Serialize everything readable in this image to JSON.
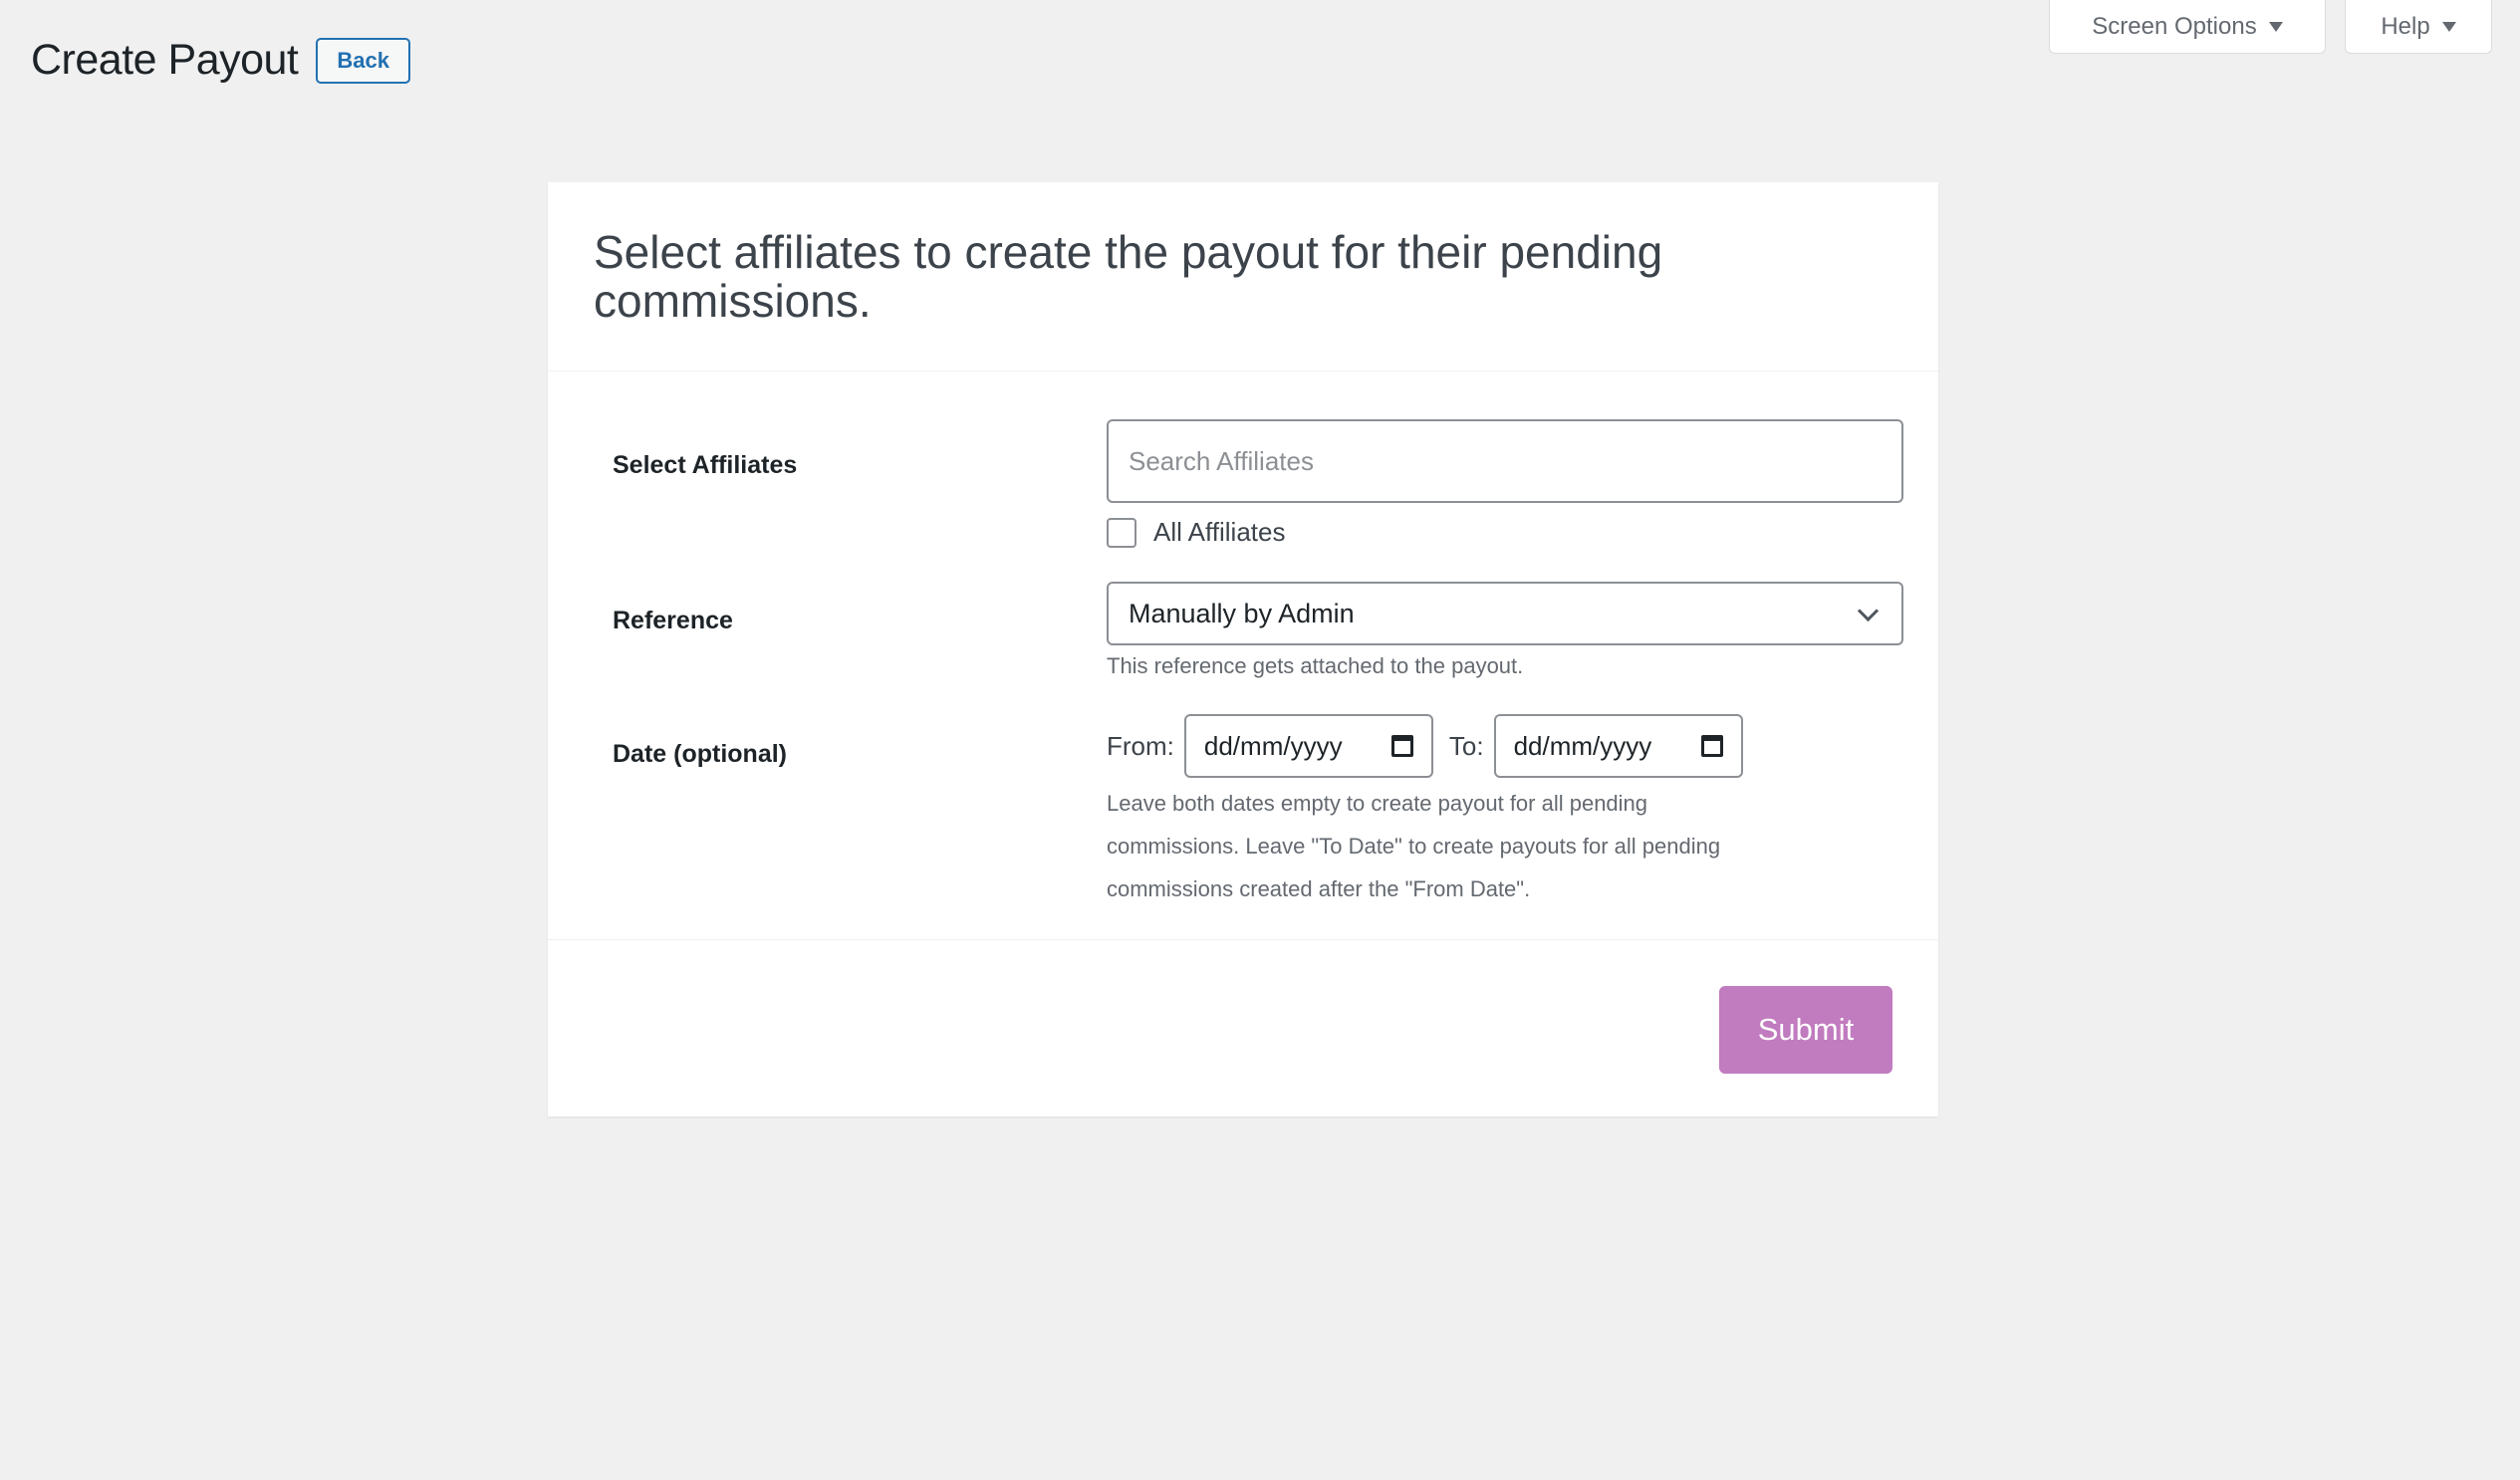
{
  "screen_meta": {
    "screen_options_label": "Screen Options",
    "help_label": "Help"
  },
  "header": {
    "title": "Create Payout",
    "back_label": "Back"
  },
  "card": {
    "heading": "Select affiliates to create the payout for their pending commissions.",
    "select_affiliates": {
      "label": "Select Affiliates",
      "search_placeholder": "Search Affiliates",
      "search_value": "",
      "all_affiliates_label": "All Affiliates",
      "all_affiliates_checked": false
    },
    "reference": {
      "label": "Reference",
      "selected": "Manually by Admin",
      "description": "This reference gets attached to the payout."
    },
    "date": {
      "label": "Date (optional)",
      "from_label": "From:",
      "from_value": "dd/mm/yyyy",
      "to_label": "To:",
      "to_value": "dd/mm/yyyy",
      "description_line1": "Leave both dates empty to create payout for all pending",
      "description_line2": "commissions. Leave \"To Date\" to create payouts for all pending",
      "description_line3": "commissions created after the \"From Date\"."
    },
    "submit_label": "Submit"
  },
  "colors": {
    "background": "#f0f0f1",
    "accent_blue": "#2271b1",
    "submit_purple": "#c17bbf"
  }
}
